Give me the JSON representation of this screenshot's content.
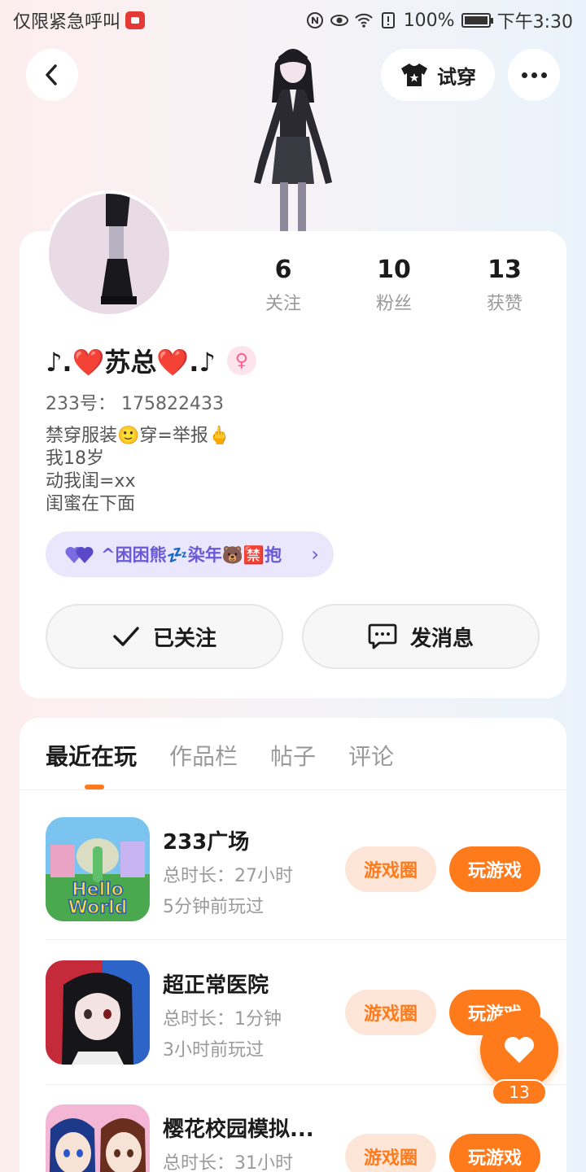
{
  "status_bar": {
    "left_text": "仅限紧急呼叫",
    "battery": "100%",
    "time": "下午3:30"
  },
  "header": {
    "tryon_label": "试穿"
  },
  "profile": {
    "stats": [
      {
        "value": "6",
        "label": "关注"
      },
      {
        "value": "10",
        "label": "粉丝"
      },
      {
        "value": "13",
        "label": "获赞"
      }
    ],
    "nickname": "♪.❤️苏总❤️.♪",
    "gender_symbol": "♀",
    "user_id": "233号： 175822433",
    "bio_lines": [
      "禁穿服装🙂穿=举报🖕",
      "我18岁",
      "动我闺=xx",
      "闺蜜在下面"
    ],
    "bestie_label": "^困困熊💤染年🐻🈲抱",
    "follow_label": "已关注",
    "message_label": "发消息"
  },
  "tabs": [
    "最近在玩",
    "作品栏",
    "帖子",
    "评论"
  ],
  "games": [
    {
      "title": "233广场",
      "duration": "总时长：27小时",
      "last_played": "5分钟前玩过",
      "circle_label": "游戏圈",
      "play_label": "玩游戏"
    },
    {
      "title": "超正常医院",
      "duration": "总时长：1分钟",
      "last_played": "3小时前玩过",
      "circle_label": "游戏圈",
      "play_label": "玩游戏"
    },
    {
      "title": "樱花校园模拟...",
      "duration": "总时长：31小时",
      "last_played": "",
      "circle_label": "游戏圈",
      "play_label": "玩游戏"
    }
  ],
  "like_count": "13",
  "colors": {
    "accent": "#ff7a1a",
    "bestie": "#6a5ad8"
  }
}
